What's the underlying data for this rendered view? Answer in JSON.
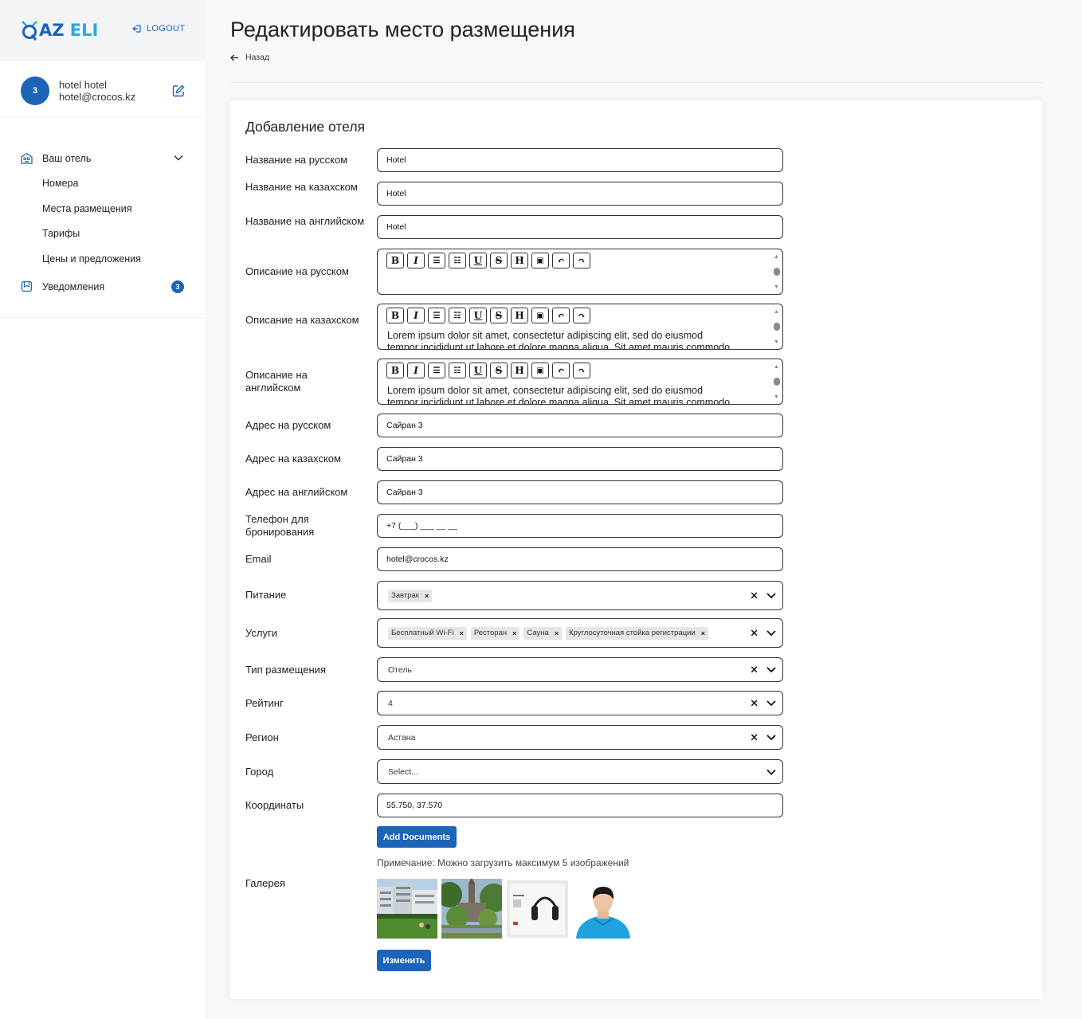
{
  "brand": {
    "logo_q": "Q",
    "logo_az": "AZ",
    "logo_eli": "ELI",
    "accent": "#1b64b8",
    "accent_light": "#29a9e7"
  },
  "header": {
    "logout_label": "LOGOUT",
    "logout_icon": "logout-icon"
  },
  "user": {
    "avatar_text": "3",
    "name": "hotel hotel",
    "email": "hotel@crocos.kz",
    "edit_icon": "edit-icon"
  },
  "sidebar": {
    "your_hotel": "Ваш отель",
    "items": [
      "Номера",
      "Места размещения",
      "Тарифы",
      "Цены и предложения"
    ],
    "notifications": "Уведомления",
    "notifications_count": "3"
  },
  "page": {
    "title": "Редактировать место размещения",
    "back_label": "Назад"
  },
  "form": {
    "title": "Добавление отеля",
    "name_ru": {
      "label": "Название на русском",
      "value": "Hotel"
    },
    "name_kz": {
      "label": "Название на казахском",
      "value": "Hotel"
    },
    "name_en": {
      "label": "Название на английском",
      "value": "Hotel"
    },
    "desc_ru": {
      "label": "Описание на русском",
      "text": "",
      "text2": ""
    },
    "desc_kz": {
      "label": "Описание на казахском",
      "text": "Lorem ipsum dolor sit amet, consectetur adipiscing elit, sed do eiusmod",
      "text2": "tempor incididunt ut labore et dolore magna aliqua. Sit amet mauris commodo"
    },
    "desc_en": {
      "label": "Описание на английском",
      "text": "Lorem ipsum dolor sit amet, consectetur adipiscing elit, sed do eiusmod",
      "text2": "tempor incididunt ut labore et dolore magna aliqua. Sit amet mauris commodo"
    },
    "toolbar": [
      "B",
      "I",
      "☰",
      "☷",
      "U",
      "S",
      "H",
      "▣",
      "↶",
      "↷"
    ],
    "addr_ru": {
      "label": "Адрес на русском",
      "value": "Сайран 3"
    },
    "addr_kz": {
      "label": "Адрес на казахском",
      "value": "Сайран 3"
    },
    "addr_en": {
      "label": "Адрес на английском",
      "value": "Сайран 3"
    },
    "phone": {
      "label": "Телефон для бронирования",
      "value": "+7 (___) ___ __ __"
    },
    "email": {
      "label": "Email",
      "value": "hotel@crocos.kz"
    },
    "food": {
      "label": "Питание",
      "chips": [
        "Завтрак"
      ]
    },
    "services": {
      "label": "Услуги",
      "chips": [
        "Бесплатный Wi-Fi",
        "Ресторан",
        "Сауна",
        "Круглосуточная стойка регистрации"
      ]
    },
    "type": {
      "label": "Тип размещения",
      "value": "Отель"
    },
    "rating": {
      "label": "Рейтинг",
      "value": "4"
    },
    "region": {
      "label": "Регион",
      "value": "Астана"
    },
    "city": {
      "label": "Город",
      "placeholder": "Select..."
    },
    "coords": {
      "label": "Координаты",
      "value": "55.750, 37.570"
    },
    "add_docs": "Add Documents",
    "note": "Примечание: Можно загрузить максимум 5 изображений",
    "gallery_label": "Галерея",
    "submit": "Изменить"
  }
}
